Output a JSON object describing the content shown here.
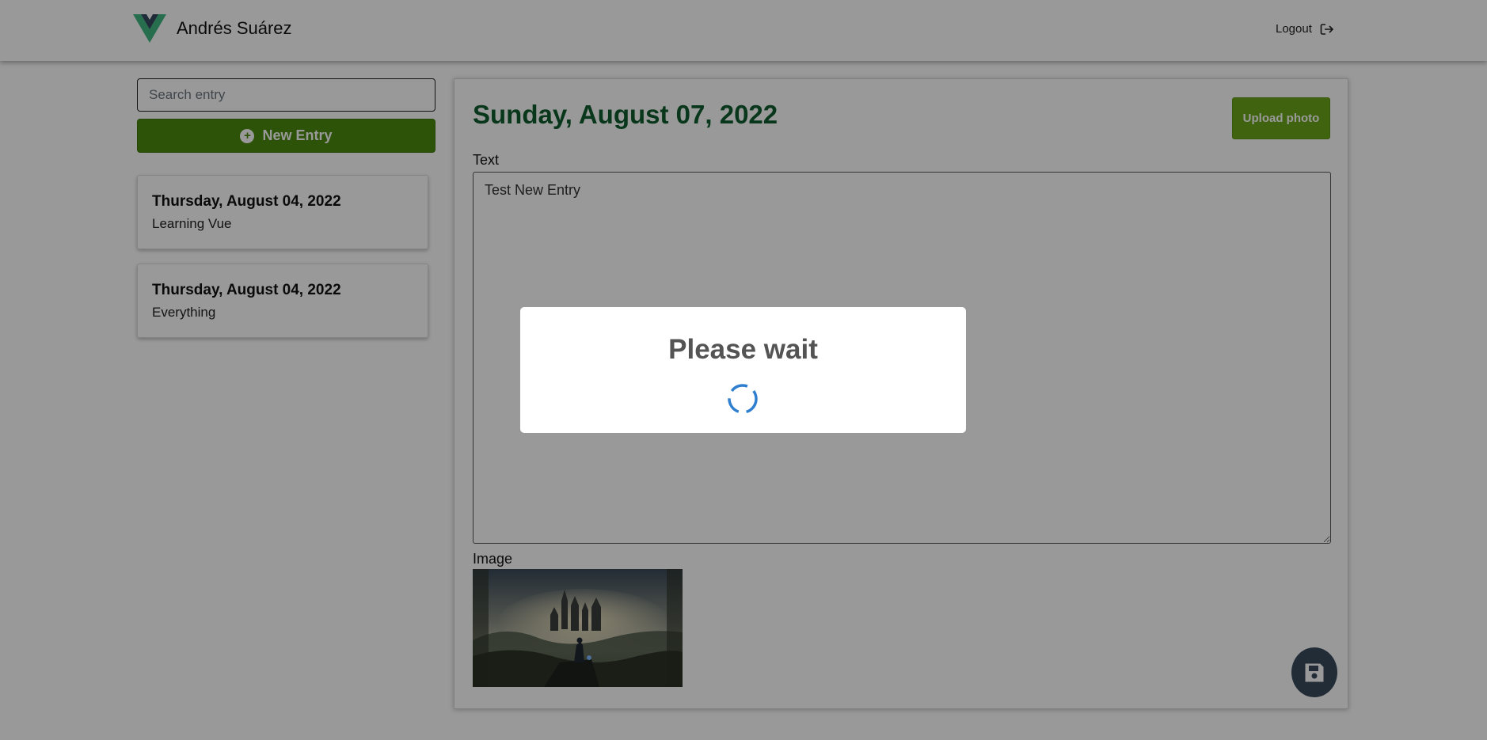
{
  "header": {
    "app_logo_icon": "vue-logo",
    "user_name": "Andrés Suárez",
    "logout_label": "Logout",
    "logout_icon": "sign-out-icon"
  },
  "sidebar": {
    "search": {
      "placeholder": "Search entry",
      "value": ""
    },
    "new_entry_label": "New Entry",
    "entries": [
      {
        "date": "Thursday, August 04, 2022",
        "snippet": "Learning Vue"
      },
      {
        "date": "Thursday, August 04, 2022",
        "snippet": "Everything"
      }
    ]
  },
  "editor": {
    "date": "Sunday, August 07, 2022",
    "upload_label": "Upload photo",
    "text_label": "Text",
    "text_value": "Test New Entry",
    "image_label": "Image",
    "save_icon": "floppy-disk-icon"
  },
  "modal": {
    "title": "Please wait",
    "spinner_icon": "loading-spinner"
  },
  "colors": {
    "primary": "#4a8a0c",
    "title": "#0f5c2e",
    "upload": "#6ca61c",
    "fab": "#3a4a5c",
    "spinner": "#2f7fd1"
  }
}
